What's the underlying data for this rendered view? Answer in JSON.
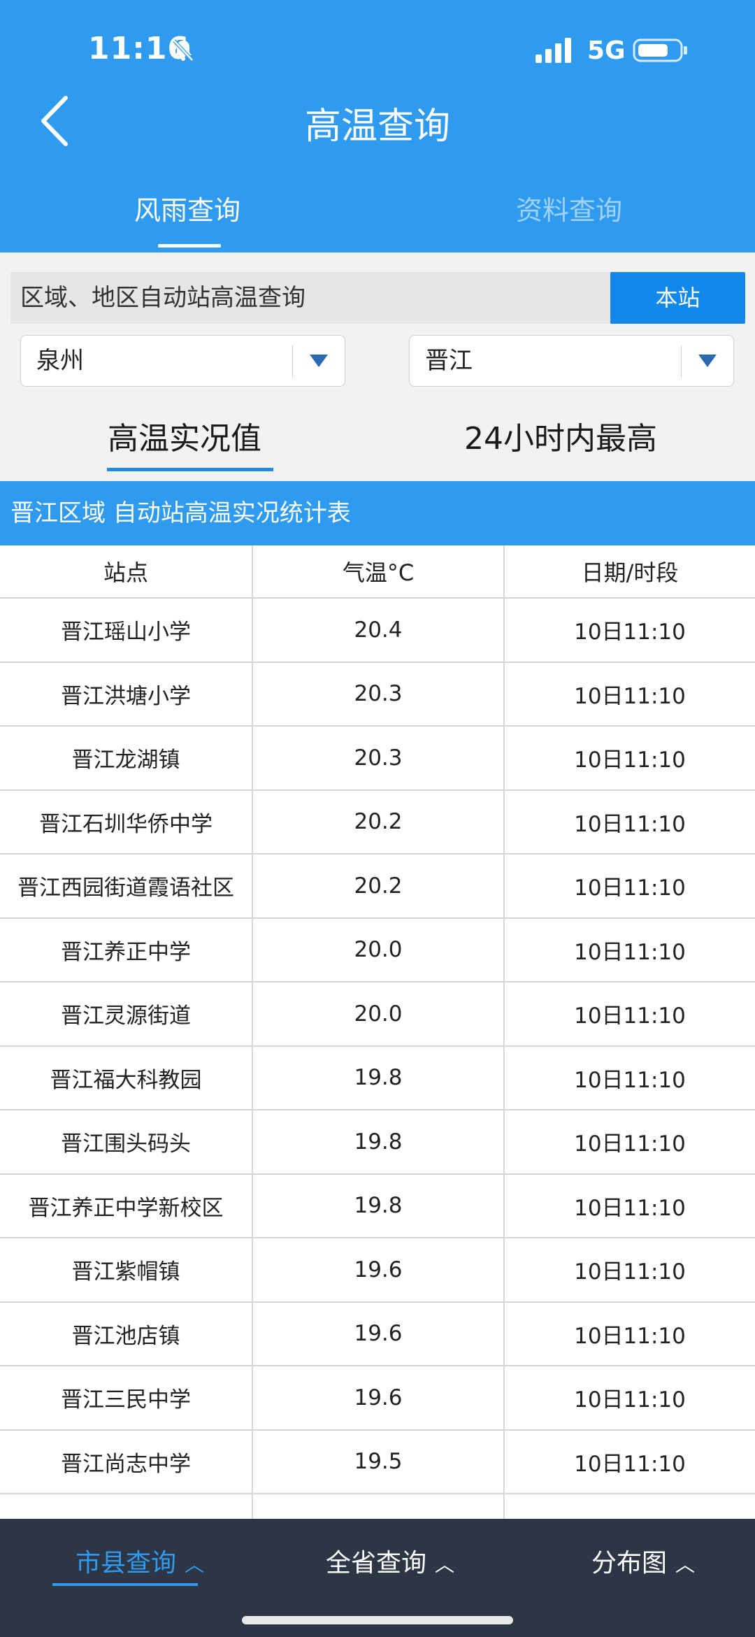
{
  "status_bar": {
    "time": "11:16",
    "network": "5G"
  },
  "header": {
    "title": "高温查询",
    "tabs": [
      {
        "label": "风雨查询",
        "active": true
      },
      {
        "label": "资料查询",
        "active": false
      }
    ]
  },
  "query": {
    "label": "区域、地区自动站高温查询",
    "station_button": "本站",
    "city_select": "泉州",
    "district_select": "晋江",
    "subtabs": [
      {
        "label": "高温实况值",
        "active": true
      },
      {
        "label": "24小时内最高",
        "active": false
      }
    ]
  },
  "table": {
    "title": "晋江区域 自动站高温实况统计表",
    "columns": [
      "站点",
      "气温°C",
      "日期/时段"
    ],
    "rows": [
      [
        "晋江瑶山小学",
        "20.4",
        "10日11:10"
      ],
      [
        "晋江洪塘小学",
        "20.3",
        "10日11:10"
      ],
      [
        "晋江龙湖镇",
        "20.3",
        "10日11:10"
      ],
      [
        "晋江石圳华侨中学",
        "20.2",
        "10日11:10"
      ],
      [
        "晋江西园街道霞语社区",
        "20.2",
        "10日11:10"
      ],
      [
        "晋江养正中学",
        "20.0",
        "10日11:10"
      ],
      [
        "晋江灵源街道",
        "20.0",
        "10日11:10"
      ],
      [
        "晋江福大科教园",
        "19.8",
        "10日11:10"
      ],
      [
        "晋江围头码头",
        "19.8",
        "10日11:10"
      ],
      [
        "晋江养正中学新校区",
        "19.8",
        "10日11:10"
      ],
      [
        "晋江紫帽镇",
        "19.6",
        "10日11:10"
      ],
      [
        "晋江池店镇",
        "19.6",
        "10日11:10"
      ],
      [
        "晋江三民中学",
        "19.6",
        "10日11:10"
      ],
      [
        "晋江尚志中学",
        "19.5",
        "10日11:10"
      ]
    ]
  },
  "bottom_nav": [
    {
      "label": "市县查询",
      "active": true
    },
    {
      "label": "全省查询",
      "active": false
    },
    {
      "label": "分布图",
      "active": false
    }
  ],
  "colors": {
    "primary": "#2f9bf0",
    "button": "#1289ea",
    "nav_bg": "#2d3644"
  },
  "icons": [
    "bell-muted-icon",
    "signal-icon",
    "battery-icon",
    "back-icon",
    "dropdown-arrow-icon",
    "chevron-up-icon"
  ]
}
